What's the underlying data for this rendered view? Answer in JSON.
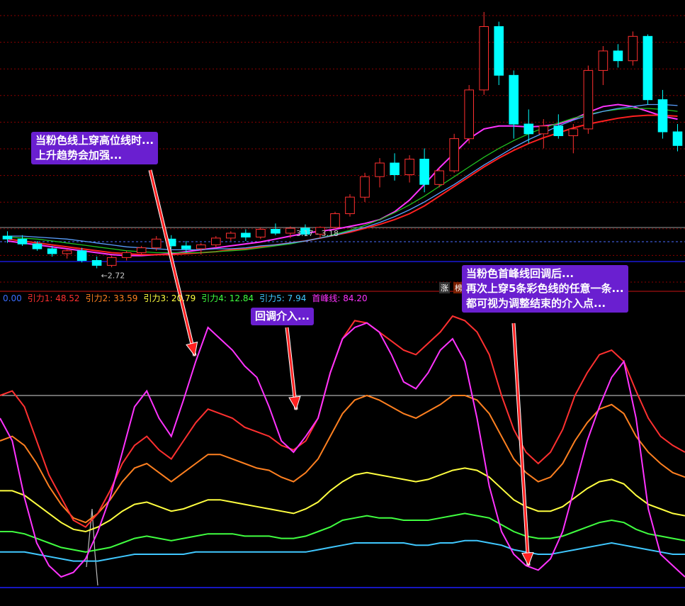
{
  "chart_data": [
    {
      "type": "candlestick",
      "title": "",
      "price_labels": {
        "low": "2.72",
        "range_marker": "3.17 - 3.18"
      },
      "moving_averages": [
        {
          "color": "#ff33ff",
          "values": [
            3.0,
            2.98,
            2.96,
            2.94,
            2.92,
            2.9,
            2.88,
            2.86,
            2.85,
            2.85,
            2.86,
            2.87,
            2.89,
            2.91,
            2.93,
            2.95,
            2.97,
            2.99,
            3.02,
            3.05,
            3.08,
            3.1,
            3.12,
            3.15,
            3.18,
            3.22,
            3.3,
            3.42,
            3.58,
            3.75,
            3.9,
            4.05,
            4.15,
            4.18,
            4.18,
            4.17,
            4.18,
            4.2,
            4.25,
            4.32,
            4.38,
            4.4,
            4.38,
            4.33,
            4.28,
            4.25
          ]
        },
        {
          "color": "#ff2020",
          "values": [
            3.02,
            3.0,
            2.98,
            2.96,
            2.94,
            2.92,
            2.9,
            2.88,
            2.87,
            2.86,
            2.86,
            2.86,
            2.87,
            2.88,
            2.89,
            2.91,
            2.92,
            2.94,
            2.96,
            2.98,
            3.0,
            3.03,
            3.06,
            3.09,
            3.13,
            3.17,
            3.22,
            3.28,
            3.36,
            3.46,
            3.56,
            3.66,
            3.76,
            3.85,
            3.93,
            4.0,
            4.06,
            4.11,
            4.16,
            4.2,
            4.23,
            4.26,
            4.28,
            4.29,
            4.29,
            4.28
          ]
        },
        {
          "color": "#20c020",
          "values": [
            3.04,
            3.03,
            3.02,
            3.0,
            2.98,
            2.96,
            2.94,
            2.92,
            2.9,
            2.89,
            2.88,
            2.88,
            2.88,
            2.88,
            2.89,
            2.9,
            2.91,
            2.93,
            2.95,
            2.97,
            3.0,
            3.03,
            3.07,
            3.11,
            3.16,
            3.22,
            3.29,
            3.37,
            3.46,
            3.56,
            3.66,
            3.76,
            3.86,
            3.95,
            4.03,
            4.1,
            4.16,
            4.21,
            4.26,
            4.3,
            4.33,
            4.35,
            4.36,
            4.36,
            4.35,
            4.33
          ]
        },
        {
          "color": "#5aa0ff",
          "values": [
            3.05,
            3.05,
            3.04,
            3.03,
            3.02,
            3.0,
            2.98,
            2.96,
            2.94,
            2.93,
            2.92,
            2.91,
            2.91,
            2.91,
            2.92,
            2.92,
            2.93,
            2.95,
            2.96,
            2.98,
            3.0,
            3.03,
            3.06,
            3.1,
            3.14,
            3.19,
            3.25,
            3.32,
            3.4,
            3.49,
            3.58,
            3.68,
            3.78,
            3.87,
            3.96,
            4.04,
            4.11,
            4.18,
            4.24,
            4.29,
            4.33,
            4.36,
            4.38,
            4.4,
            4.4,
            4.39
          ]
        }
      ],
      "candles": [
        {
          "o": 3.05,
          "h": 3.1,
          "l": 2.98,
          "c": 3.02
        },
        {
          "o": 3.02,
          "h": 3.06,
          "l": 2.95,
          "c": 2.97
        },
        {
          "o": 2.97,
          "h": 3.0,
          "l": 2.9,
          "c": 2.92
        },
        {
          "o": 2.92,
          "h": 2.95,
          "l": 2.84,
          "c": 2.87
        },
        {
          "o": 2.87,
          "h": 2.92,
          "l": 2.82,
          "c": 2.9
        },
        {
          "o": 2.9,
          "h": 2.93,
          "l": 2.78,
          "c": 2.8
        },
        {
          "o": 2.8,
          "h": 2.84,
          "l": 2.72,
          "c": 2.75
        },
        {
          "o": 2.75,
          "h": 2.85,
          "l": 2.73,
          "c": 2.83
        },
        {
          "o": 2.83,
          "h": 2.9,
          "l": 2.8,
          "c": 2.88
        },
        {
          "o": 2.88,
          "h": 2.95,
          "l": 2.85,
          "c": 2.93
        },
        {
          "o": 2.93,
          "h": 3.05,
          "l": 2.9,
          "c": 3.02
        },
        {
          "o": 3.02,
          "h": 3.06,
          "l": 2.92,
          "c": 2.95
        },
        {
          "o": 2.95,
          "h": 3.0,
          "l": 2.88,
          "c": 2.92
        },
        {
          "o": 2.92,
          "h": 2.98,
          "l": 2.86,
          "c": 2.96
        },
        {
          "o": 2.96,
          "h": 3.05,
          "l": 2.93,
          "c": 3.03
        },
        {
          "o": 3.03,
          "h": 3.1,
          "l": 3.0,
          "c": 3.08
        },
        {
          "o": 3.08,
          "h": 3.12,
          "l": 3.0,
          "c": 3.04
        },
        {
          "o": 3.04,
          "h": 3.14,
          "l": 3.02,
          "c": 3.12
        },
        {
          "o": 3.12,
          "h": 3.18,
          "l": 3.06,
          "c": 3.08
        },
        {
          "o": 3.08,
          "h": 3.15,
          "l": 3.03,
          "c": 3.13
        },
        {
          "o": 3.13,
          "h": 3.17,
          "l": 3.05,
          "c": 3.07
        },
        {
          "o": 3.07,
          "h": 3.15,
          "l": 3.03,
          "c": 3.14
        },
        {
          "o": 3.14,
          "h": 3.3,
          "l": 3.12,
          "c": 3.28
        },
        {
          "o": 3.28,
          "h": 3.48,
          "l": 3.25,
          "c": 3.45
        },
        {
          "o": 3.45,
          "h": 3.7,
          "l": 3.4,
          "c": 3.66
        },
        {
          "o": 3.66,
          "h": 3.85,
          "l": 3.55,
          "c": 3.8
        },
        {
          "o": 3.8,
          "h": 3.9,
          "l": 3.62,
          "c": 3.68
        },
        {
          "o": 3.68,
          "h": 3.88,
          "l": 3.6,
          "c": 3.84
        },
        {
          "o": 3.84,
          "h": 3.95,
          "l": 3.5,
          "c": 3.58
        },
        {
          "o": 3.58,
          "h": 3.75,
          "l": 3.55,
          "c": 3.72
        },
        {
          "o": 3.72,
          "h": 4.1,
          "l": 3.7,
          "c": 4.05
        },
        {
          "o": 4.05,
          "h": 4.6,
          "l": 4.0,
          "c": 4.55
        },
        {
          "o": 4.55,
          "h": 5.35,
          "l": 4.5,
          "c": 5.2
        },
        {
          "o": 5.2,
          "h": 5.25,
          "l": 4.6,
          "c": 4.7
        },
        {
          "o": 4.7,
          "h": 4.75,
          "l": 4.05,
          "c": 4.2
        },
        {
          "o": 4.2,
          "h": 4.35,
          "l": 4.0,
          "c": 4.1
        },
        {
          "o": 4.1,
          "h": 4.25,
          "l": 3.95,
          "c": 4.18
        },
        {
          "o": 4.18,
          "h": 4.3,
          "l": 4.05,
          "c": 4.08
        },
        {
          "o": 4.08,
          "h": 4.2,
          "l": 3.9,
          "c": 4.15
        },
        {
          "o": 4.15,
          "h": 4.8,
          "l": 4.1,
          "c": 4.75
        },
        {
          "o": 4.75,
          "h": 5.0,
          "l": 4.6,
          "c": 4.95
        },
        {
          "o": 4.95,
          "h": 5.02,
          "l": 4.78,
          "c": 4.85
        },
        {
          "o": 4.85,
          "h": 5.15,
          "l": 4.8,
          "c": 5.1
        },
        {
          "o": 5.1,
          "h": 5.12,
          "l": 4.4,
          "c": 4.45
        },
        {
          "o": 4.45,
          "h": 4.55,
          "l": 4.05,
          "c": 4.12
        },
        {
          "o": 4.12,
          "h": 4.2,
          "l": 3.92,
          "c": 3.98
        }
      ]
    },
    {
      "type": "line",
      "title": "",
      "legend": [
        {
          "label": "0.00",
          "color": "#3a6dff"
        },
        {
          "label": "引力1: 48.52",
          "color": "#ff3030"
        },
        {
          "label": "引力2: 33.59",
          "color": "#ff8020"
        },
        {
          "label": "引力3: 20.79",
          "color": "#ffff40"
        },
        {
          "label": "引力4: 12.84",
          "color": "#40ff40"
        },
        {
          "label": "引力5: 7.94",
          "color": "#40c8ff"
        },
        {
          "label": "首峰线: 84.20",
          "color": "#ff33ff"
        }
      ],
      "ylim": [
        -5,
        120
      ],
      "reference_level": 80,
      "series": [
        {
          "name": "首峰线",
          "color": "#ff33ff",
          "values": [
            70,
            60,
            35,
            15,
            5,
            0,
            2,
            8,
            20,
            35,
            55,
            75,
            82,
            70,
            62,
            78,
            95,
            110,
            105,
            100,
            93,
            88,
            75,
            60,
            55,
            62,
            70,
            90,
            105,
            110,
            112,
            108,
            98,
            86,
            83,
            90,
            100,
            105,
            95,
            70,
            40,
            20,
            10,
            5,
            3,
            8,
            20,
            40,
            60,
            75,
            88,
            95,
            70,
            30,
            10,
            5,
            0
          ]
        },
        {
          "name": "引力1",
          "color": "#ff3030",
          "values": [
            80,
            82,
            75,
            60,
            45,
            35,
            25,
            22,
            28,
            38,
            50,
            58,
            62,
            56,
            52,
            60,
            68,
            74,
            72,
            70,
            66,
            64,
            62,
            58,
            56,
            60,
            70,
            90,
            105,
            113,
            112,
            108,
            104,
            100,
            98,
            103,
            108,
            115,
            113,
            108,
            98,
            80,
            65,
            55,
            50,
            55,
            65,
            80,
            90,
            98,
            100,
            95,
            82,
            70,
            62,
            58,
            55
          ]
        },
        {
          "name": "引力2",
          "color": "#ff8020",
          "values": [
            60,
            62,
            58,
            50,
            40,
            32,
            26,
            24,
            28,
            34,
            42,
            48,
            50,
            46,
            42,
            46,
            50,
            54,
            54,
            52,
            50,
            48,
            47,
            44,
            42,
            46,
            52,
            62,
            72,
            78,
            80,
            78,
            75,
            72,
            70,
            73,
            76,
            80,
            80,
            78,
            72,
            62,
            52,
            46,
            42,
            44,
            50,
            60,
            68,
            74,
            76,
            72,
            62,
            55,
            50,
            46,
            44
          ]
        },
        {
          "name": "引力3",
          "color": "#ffff40",
          "values": [
            38,
            38,
            36,
            32,
            28,
            24,
            21,
            20,
            22,
            25,
            29,
            32,
            33,
            31,
            29,
            30,
            32,
            34,
            34,
            33,
            32,
            31,
            30,
            29,
            28,
            30,
            33,
            38,
            42,
            45,
            46,
            45,
            44,
            43,
            42,
            43,
            45,
            47,
            48,
            47,
            44,
            39,
            34,
            31,
            29,
            29,
            31,
            35,
            39,
            42,
            43,
            41,
            36,
            32,
            30,
            28,
            27
          ]
        },
        {
          "name": "引力4",
          "color": "#40ff40",
          "values": [
            20,
            20,
            19,
            17,
            15,
            13,
            12,
            11,
            12,
            13,
            15,
            17,
            18,
            17,
            16,
            17,
            18,
            19,
            19,
            19,
            18,
            18,
            18,
            17,
            17,
            18,
            20,
            22,
            25,
            26,
            27,
            26,
            26,
            25,
            25,
            25,
            26,
            27,
            28,
            27,
            26,
            23,
            20,
            18,
            17,
            17,
            18,
            20,
            22,
            24,
            25,
            24,
            21,
            19,
            18,
            17,
            16
          ]
        },
        {
          "name": "引力5",
          "color": "#40c8ff",
          "values": [
            11,
            11,
            11,
            10,
            9,
            8,
            7,
            7,
            7,
            8,
            9,
            10,
            10,
            10,
            10,
            10,
            11,
            11,
            11,
            11,
            11,
            11,
            11,
            11,
            11,
            11,
            12,
            13,
            14,
            15,
            15,
            15,
            15,
            15,
            14,
            14,
            15,
            15,
            16,
            16,
            15,
            14,
            12,
            11,
            10,
            10,
            11,
            12,
            13,
            14,
            15,
            14,
            13,
            12,
            11,
            10,
            10
          ]
        }
      ]
    }
  ],
  "badges": [
    "涨",
    "榜"
  ],
  "annotations": [
    {
      "lines": [
        "当粉色线上穿高位线时...",
        "上升趋势会加强..."
      ]
    },
    {
      "lines": [
        "回调介入..."
      ]
    },
    {
      "lines": [
        "当粉色首峰线回调后...",
        "再次上穿5条彩色线的任意一条...",
        "都可视为调整结束的介入点..."
      ]
    }
  ],
  "colors": {
    "up_candle": "#ff3030",
    "down_candle": "#00ffff",
    "grid": "#8b0000",
    "axis_line": "#1f1fff",
    "arrow": "#ff2020",
    "annotation_bg": "#6a1fd0"
  }
}
